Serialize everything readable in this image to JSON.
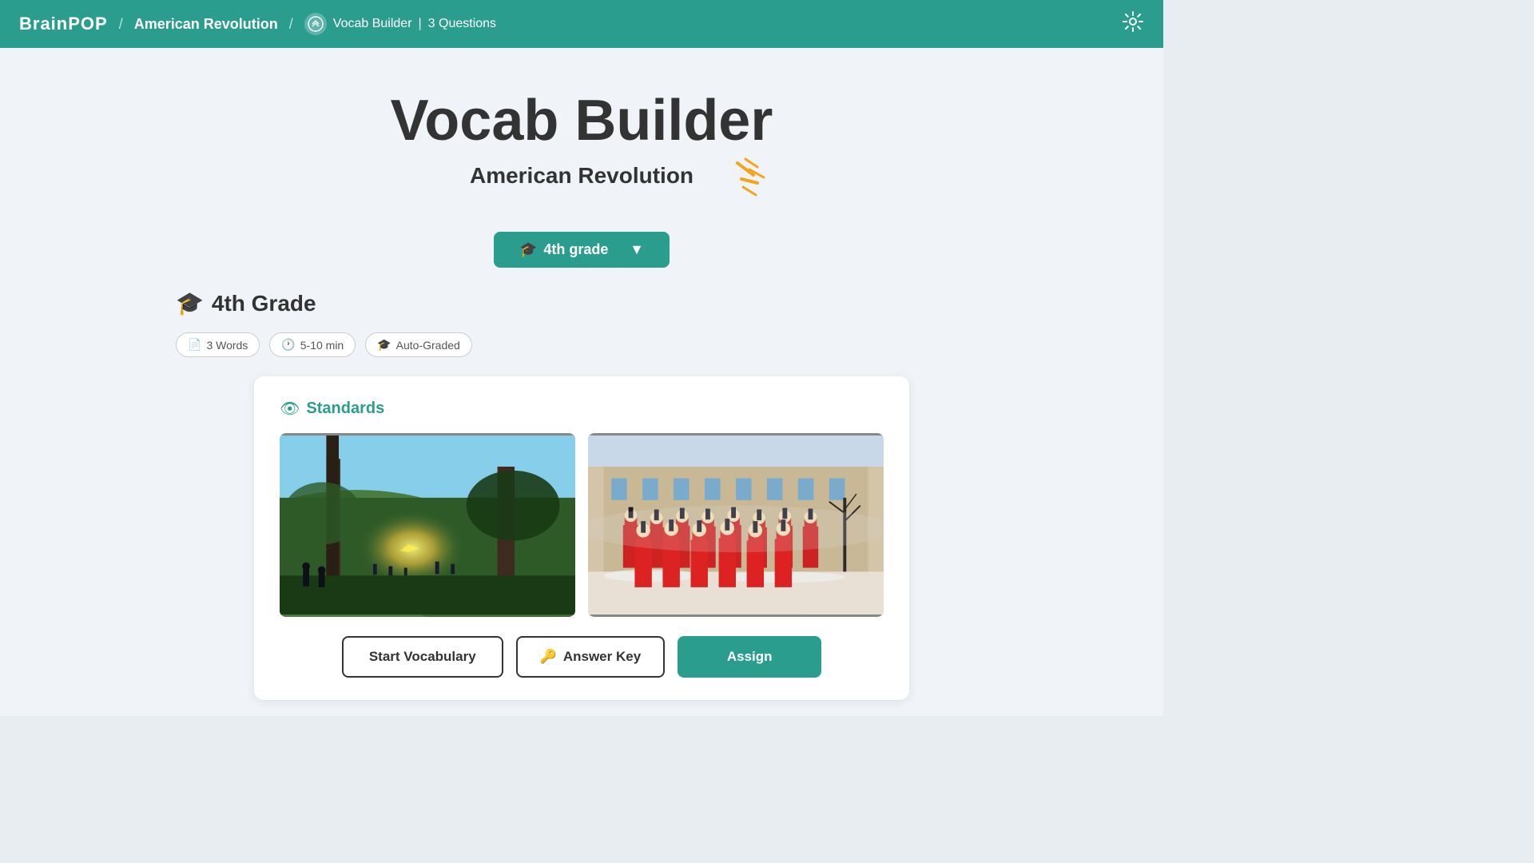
{
  "header": {
    "logo": "BrainPOP",
    "separator1": "/",
    "topic": "American Revolution",
    "separator2": "/",
    "vocab_label": "Vocab Builder",
    "pipe": "|",
    "questions": "3 Questions"
  },
  "page": {
    "title": "Vocab Builder",
    "subtitle": "American Revolution",
    "grade_dropdown": "4th grade",
    "grade_heading": "4th Grade"
  },
  "badges": [
    {
      "label": "3 Words",
      "icon": "📄"
    },
    {
      "label": "5-10 min",
      "icon": "🕐"
    },
    {
      "label": "Auto-Graded",
      "icon": "🎓"
    }
  ],
  "card": {
    "standards_label": "Standards"
  },
  "buttons": {
    "start": "Start Vocabulary",
    "answer_key": "Answer Key",
    "assign": "Assign"
  },
  "colors": {
    "teal": "#2a9d8f",
    "dark": "#333333",
    "light_bg": "#f0f4f8",
    "badge_border": "#cccccc",
    "gold": "#f4a41d"
  }
}
